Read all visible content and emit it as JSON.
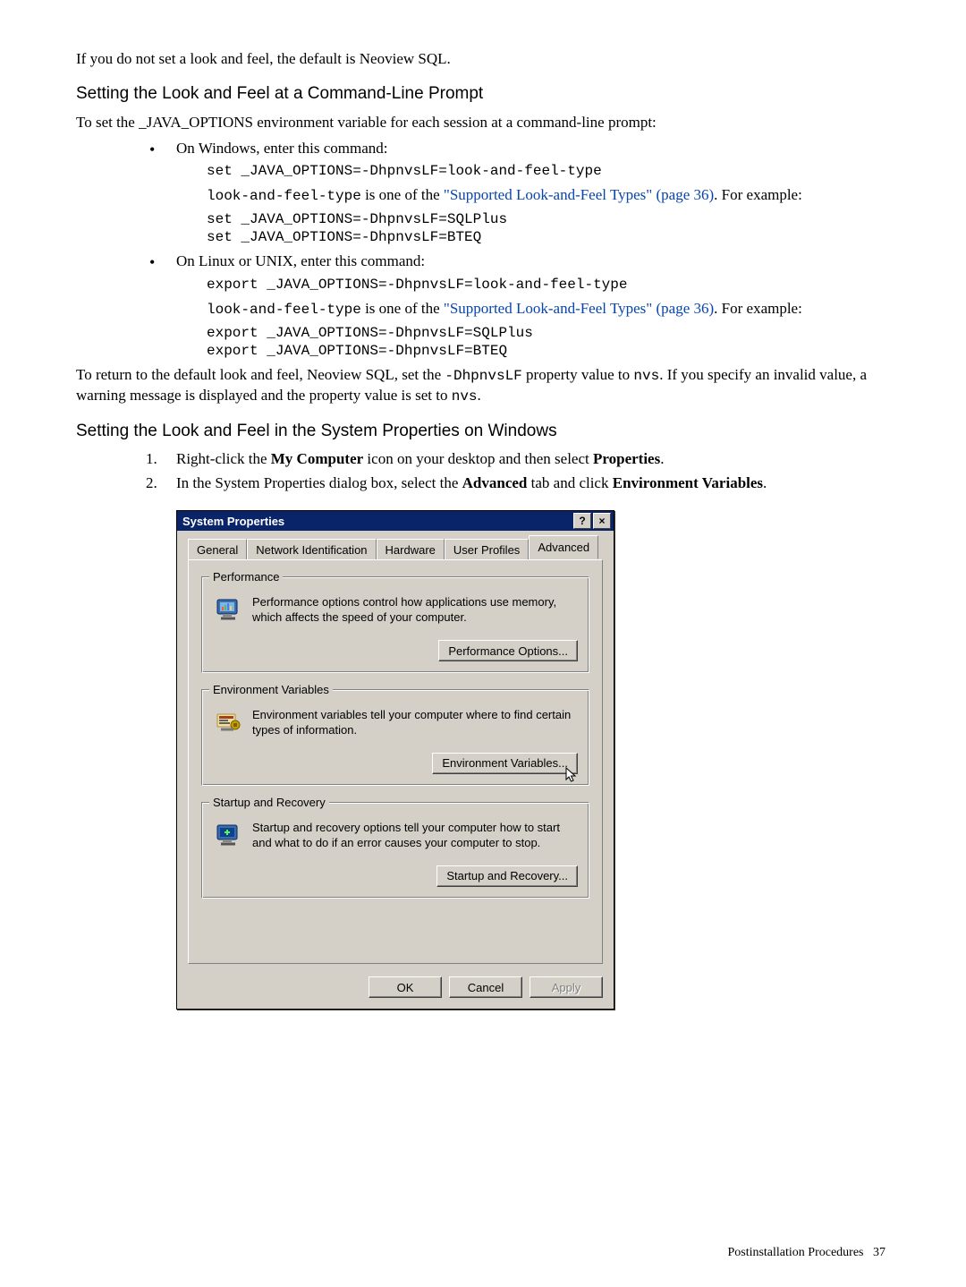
{
  "doc": {
    "p1": "If you do not set a look and feel, the default is Neoview SQL.",
    "h1": "Setting the Look and Feel at a Command-Line Prompt",
    "p2": "To set the _JAVA_OPTIONS environment variable for each session at a command-line prompt:",
    "b1": {
      "lead": "On Windows, enter this command:",
      "code1": "set _JAVA_OPTIONS=-DhpnvsLF=look-and-feel-type",
      "text1a": "look-and-feel-type",
      "text1b": " is one of the ",
      "link": "\"Supported Look-and-Feel Types\" (page 36)",
      "text1c": ". For example:",
      "code2": "set _JAVA_OPTIONS=-DhpnvsLF=SQLPlus\nset _JAVA_OPTIONS=-DhpnvsLF=BTEQ"
    },
    "b2": {
      "lead": "On Linux or UNIX, enter this command:",
      "code1": "export _JAVA_OPTIONS=-DhpnvsLF=look-and-feel-type",
      "text1a": "look-and-feel-type",
      "text1b": " is one of the ",
      "link": "\"Supported Look-and-Feel Types\" (page 36)",
      "text1c": ". For example:",
      "code2": "export _JAVA_OPTIONS=-DhpnvsLF=SQLPlus\nexport _JAVA_OPTIONS=-DhpnvsLF=BTEQ"
    },
    "p3a": "To return to the default look and feel, Neoview SQL, set the ",
    "p3b": "-DhpnvsLF",
    "p3c": " property value to ",
    "p3d": "nvs",
    "p3e": ". If you specify an invalid value, a warning message is displayed and the property value is set to ",
    "p3f": "nvs",
    "p3g": ".",
    "h2": "Setting the Look and Feel in the System Properties on Windows",
    "step1a": "Right-click the ",
    "step1b": "My Computer",
    "step1c": " icon on your desktop and then select ",
    "step1d": "Properties",
    "step1e": ".",
    "step2a": "In the System Properties dialog box, select the ",
    "step2b": "Advanced",
    "step2c": " tab and click ",
    "step2d": "Environment Variables",
    "step2e": "."
  },
  "dialog": {
    "title": "System Properties",
    "help": "?",
    "close": "×",
    "tabs": {
      "general": "General",
      "network": "Network Identification",
      "hardware": "Hardware",
      "profiles": "User Profiles",
      "advanced": "Advanced"
    },
    "perf": {
      "legend": "Performance",
      "text": "Performance options control how applications use memory, which affects the speed of your computer.",
      "button": "Performance Options..."
    },
    "env": {
      "legend": "Environment Variables",
      "text": "Environment variables tell your computer where to find certain types of information.",
      "button": "Environment Variables..."
    },
    "startup": {
      "legend": "Startup and Recovery",
      "text": "Startup and recovery options tell your computer how to start and what to do if an error causes your computer to stop.",
      "button": "Startup and Recovery..."
    },
    "ok": "OK",
    "cancel": "Cancel",
    "apply": "Apply"
  },
  "footer": {
    "label": "Postinstallation Procedures",
    "page": "37"
  }
}
